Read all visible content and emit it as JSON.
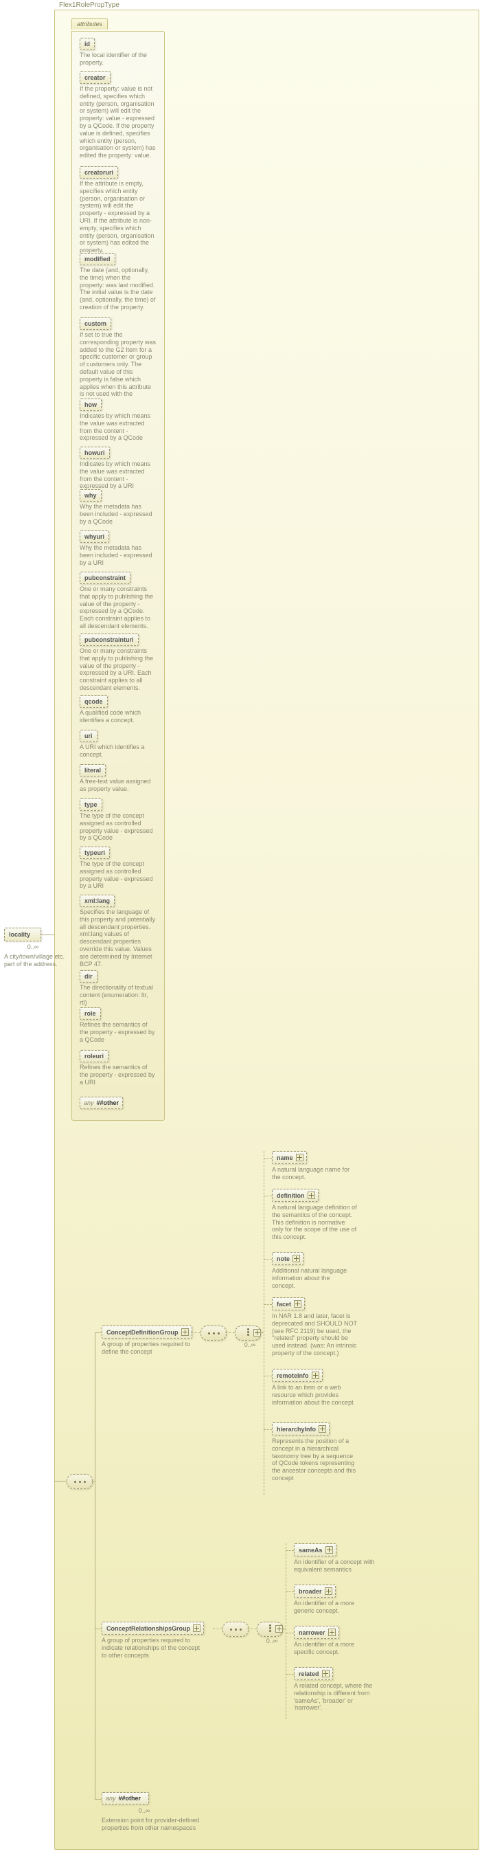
{
  "type_label": "Flex1RolePropType",
  "root": {
    "name": "locality",
    "occ": "0..∞",
    "desc": "A city/town/village etc. part of the address."
  },
  "attributes_tab": "attributes",
  "attributes": [
    {
      "name": "id",
      "desc": "The local identifier of the property."
    },
    {
      "name": "creator",
      "desc": "If the property: value is not defined, specifies which entity (person, organisation or system) will edit the property: value - expressed by a QCode. If the property value is defined, specifies which entity (person, organisation or system) has edited the property: value."
    },
    {
      "name": "creatoruri",
      "desc": "If the attribute is empty, specifies which entity (person, organisation or system) will edit the property - expressed by a URI. If the attribute is non-empty, specifies which entity (person, organisation or system) has edited the property."
    },
    {
      "name": "modified",
      "desc": "The date (and, optionally, the time) when the property: was last modified. The initial value is the date (and, optionally, the time) of creation of the property."
    },
    {
      "name": "custom",
      "desc": "If set to true the corresponding property was added to the G2 Item for a specific customer or group of customers only. The default value of this property is false which applies when this attribute is not used with the property."
    },
    {
      "name": "how",
      "desc": "Indicates by which means the value was extracted from the content - expressed by a QCode"
    },
    {
      "name": "howuri",
      "desc": "Indicates by which means the value was extracted from the content - expressed by a URI"
    },
    {
      "name": "why",
      "desc": "Why the metadata has been included - expressed by a QCode"
    },
    {
      "name": "whyuri",
      "desc": "Why the metadata has been included - expressed by a URI"
    },
    {
      "name": "pubconstraint",
      "desc": "One or many constraints that apply to publishing the value of the property - expressed by a QCode. Each constraint applies to all descendant elements."
    },
    {
      "name": "pubconstrainturi",
      "desc": "One or many constraints that apply to publishing the value of the property - expressed by a URI. Each constraint applies to all descendant elements."
    },
    {
      "name": "qcode",
      "desc": "A qualified code which identifies a concept."
    },
    {
      "name": "uri",
      "desc": "A URI which identifies a concept."
    },
    {
      "name": "literal",
      "desc": "A free-text value assigned as property value."
    },
    {
      "name": "type",
      "desc": "The type of the concept assigned as controlled property value - expressed by a QCode"
    },
    {
      "name": "typeuri",
      "desc": "The type of the concept assigned as controlled property value - expressed by a URI"
    },
    {
      "name": "xml:lang",
      "desc": "Specifies the language of this property and potentially all descendant properties. xml:lang values of descendant properties override this value. Values are determined by Internet BCP 47."
    },
    {
      "name": "dir",
      "desc": "The directionality of textual content (enumeration: ltr, rtl)"
    },
    {
      "name": "role",
      "desc": "Refines the semantics of the property - expressed by a QCode"
    },
    {
      "name": "roleuri",
      "desc": "Refines the semantics of the property - expressed by a URI"
    }
  ],
  "any_other_attr": "##other",
  "any_label": "any",
  "cdg": {
    "name": "ConceptDefinitionGroup",
    "desc": "A group of properties required to define the concept"
  },
  "cdg_children": [
    {
      "name": "name",
      "desc": "A natural language name for the concept."
    },
    {
      "name": "definition",
      "desc": "A natural language definition of the semantics of the concept. This definition is normative only for the scope of the use of this concept."
    },
    {
      "name": "note",
      "desc": "Additional natural language information about the concept."
    },
    {
      "name": "facet",
      "desc": "In NAR 1.8 and later, facet is deprecated and SHOULD NOT (see RFC 2119) be used, the \"related\" property should be used instead. (was: An intrinsic property of the concept.)"
    },
    {
      "name": "remoteInfo",
      "desc": "A link to an item or a web resource which provides information about the concept"
    },
    {
      "name": "hierarchyInfo",
      "desc": "Represents the position of a concept in a hierarchical taxonomy tree by a sequence of QCode tokens representing the ancestor concepts and this concept"
    }
  ],
  "cdg_occ": "0..∞",
  "crg": {
    "name": "ConceptRelationshipsGroup",
    "desc": "A group of properties required to indicate relationships of the concept to other concepts"
  },
  "crg_children": [
    {
      "name": "sameAs",
      "desc": "An identifier of a concept with equivalent semantics"
    },
    {
      "name": "broader",
      "desc": "An identifier of a more generic concept."
    },
    {
      "name": "narrower",
      "desc": "An identifier of a more specific concept."
    },
    {
      "name": "related",
      "desc": "A related concept, where the relationship is different from 'sameAs', 'broader' or 'narrower'."
    }
  ],
  "crg_occ": "0..∞",
  "bottom_any": {
    "ns": "##other",
    "occ": "0..∞",
    "desc": "Extension point for provider-defined properties from other namespaces"
  }
}
